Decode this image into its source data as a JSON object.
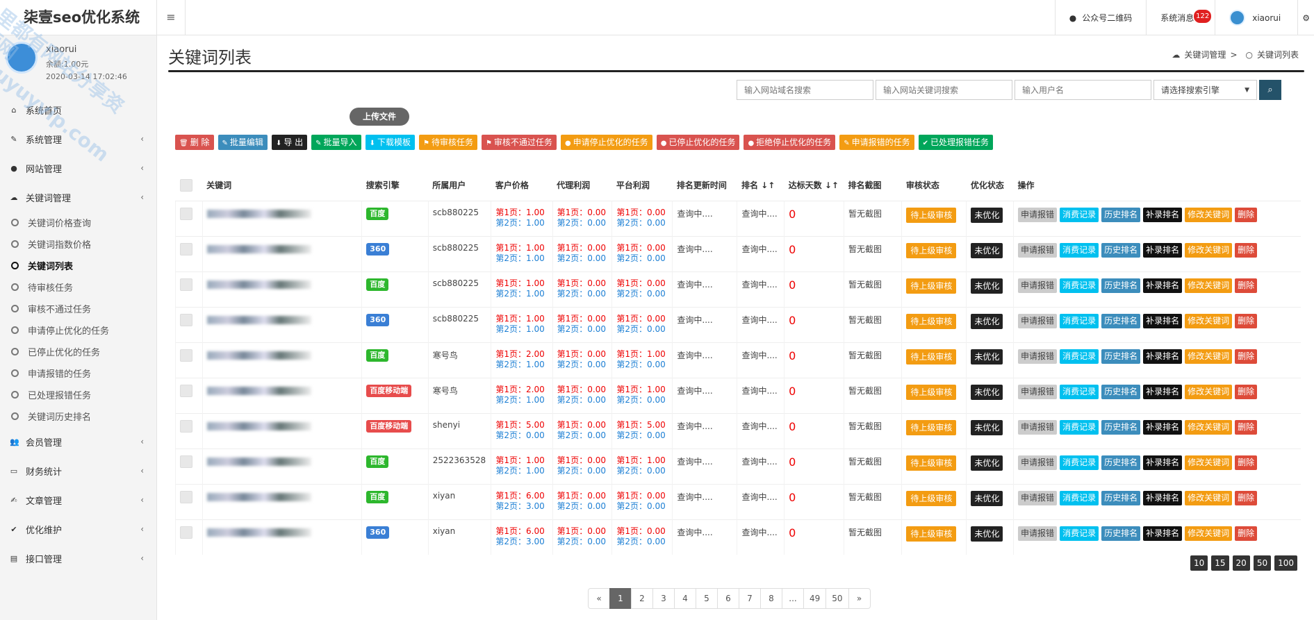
{
  "brand": "柒壹seo优化系统",
  "topbar": {
    "menu_icon": "≡",
    "wechat": "公众号二维码",
    "messages": "系统消息",
    "msg_count": "122",
    "user": "xiaorui",
    "gear": "⚙"
  },
  "user": {
    "name": "xiaorui",
    "balance": "余额:1.00元",
    "time": "2020-03-14 17:02:46"
  },
  "watermark": {
    "line1": "里都有网站分享资源网",
    "line2": "uyuyvip.com"
  },
  "sidebar": {
    "items": [
      {
        "label": "系统首页",
        "icon": "⌂"
      },
      {
        "label": "系统管理",
        "icon": "✎",
        "arrow": "‹"
      },
      {
        "label": "网站管理",
        "icon": "●",
        "arrow": "‹"
      },
      {
        "label": "关键词管理",
        "icon": "☁",
        "arrow": "‹"
      },
      {
        "label": "会员管理",
        "icon": "👥",
        "arrow": "‹"
      },
      {
        "label": "财务统计",
        "icon": "▭",
        "arrow": "‹"
      },
      {
        "label": "文章管理",
        "icon": "✍",
        "arrow": "‹"
      },
      {
        "label": "优化维护",
        "icon": "✔",
        "arrow": "‹"
      },
      {
        "label": "接口管理",
        "icon": "▤",
        "arrow": "‹"
      }
    ],
    "sub": [
      "关键词价格查询",
      "关键词指数价格",
      "关键词列表",
      "待审核任务",
      "审核不通过任务",
      "申请停止优化的任务",
      "已停止优化的任务",
      "申请报错的任务",
      "已处理报错任务",
      "关键词历史排名"
    ]
  },
  "page": {
    "title": "关键词列表",
    "crumb1": "关键词管理",
    "crumb_sep": ">",
    "crumb2": "关键词列表"
  },
  "search": {
    "domain_ph": "输入网站域名搜索",
    "kw_ph": "输入网站关键词搜索",
    "user_ph": "输入用户名",
    "engine": "请选择搜索引擎",
    "arrow": "▼",
    "icon": "🔍"
  },
  "upload": "上传文件",
  "toolbar": [
    "删 除",
    "批量编辑",
    "导 出",
    "批量导入",
    "下载模板",
    "待审核任务",
    "审核不通过任务",
    "申请停止优化的任务",
    "已停止优化的任务",
    "拒绝停止优化的任务",
    "申请报错的任务",
    "已处理报错任务"
  ],
  "toolbar_icons": [
    "🗑",
    "✎",
    "⬇",
    "✎",
    "⬇",
    "⚑",
    "⚑",
    "●",
    "●",
    "●",
    "✎",
    "✔"
  ],
  "table": {
    "headers": [
      "",
      "关键词",
      "",
      "搜索引擎",
      "所属用户",
      "客户价格",
      "代理利润",
      "平台利润",
      "排名更新时间",
      "排名 ↓↑",
      "达标天数 ↓↑",
      "排名截图",
      "审核状态",
      "优化状态",
      "操作"
    ],
    "rows": [
      {
        "engine": "百度",
        "user": "scb880225",
        "p1": "第1页：1.00",
        "p2": "第2页：1.00",
        "a1": "第1页：0.00",
        "a2": "第2页：0.00",
        "f1": "第1页：0.00",
        "f2": "第2页：0.00"
      },
      {
        "engine": "360",
        "user": "scb880225",
        "p1": "第1页：1.00",
        "p2": "第2页：1.00",
        "a1": "第1页：0.00",
        "a2": "第2页：0.00",
        "f1": "第1页：0.00",
        "f2": "第2页：0.00"
      },
      {
        "engine": "百度",
        "user": "scb880225",
        "p1": "第1页：1.00",
        "p2": "第2页：1.00",
        "a1": "第1页：0.00",
        "a2": "第2页：0.00",
        "f1": "第1页：0.00",
        "f2": "第2页：0.00"
      },
      {
        "engine": "360",
        "user": "scb880225",
        "p1": "第1页：1.00",
        "p2": "第2页：1.00",
        "a1": "第1页：0.00",
        "a2": "第2页：0.00",
        "f1": "第1页：0.00",
        "f2": "第2页：0.00"
      },
      {
        "engine": "百度",
        "user": "寒号鸟",
        "p1": "第1页：2.00",
        "p2": "第2页：1.00",
        "a1": "第1页：0.00",
        "a2": "第2页：0.00",
        "f1": "第1页：1.00",
        "f2": "第2页：0.00"
      },
      {
        "engine": "百度移动端",
        "user": "寒号鸟",
        "p1": "第1页：2.00",
        "p2": "第2页：1.00",
        "a1": "第1页：0.00",
        "a2": "第2页：0.00",
        "f1": "第1页：1.00",
        "f2": "第2页：0.00"
      },
      {
        "engine": "百度移动端",
        "user": "shenyi",
        "p1": "第1页：5.00",
        "p2": "第2页：0.00",
        "a1": "第1页：0.00",
        "a2": "第2页：0.00",
        "f1": "第1页：5.00",
        "f2": "第2页：0.00"
      },
      {
        "engine": "百度",
        "user": "2522363528",
        "p1": "第1页：1.00",
        "p2": "第2页：1.00",
        "a1": "第1页：0.00",
        "a2": "第2页：0.00",
        "f1": "第1页：1.00",
        "f2": "第2页：0.00"
      },
      {
        "engine": "百度",
        "user": "xiyan",
        "p1": "第1页：6.00",
        "p2": "第2页：3.00",
        "a1": "第1页：0.00",
        "a2": "第2页：0.00",
        "f1": "第1页：0.00",
        "f2": "第2页：0.00"
      },
      {
        "engine": "360",
        "user": "xiyan",
        "p1": "第1页：6.00",
        "p2": "第2页：3.00",
        "a1": "第1页：0.00",
        "a2": "第2页：0.00",
        "f1": "第1页：0.00",
        "f2": "第2页：0.00"
      }
    ],
    "querying": "查询中....",
    "rank": "查询中....",
    "days": "0",
    "screenshot": "暂无截图",
    "audit": "待上级审核",
    "opt": "未优化",
    "ops": [
      "申请报错",
      "消费记录",
      "历史排名",
      "补录排名",
      "修改关键词",
      "删除"
    ]
  },
  "pagesize": [
    "10",
    "15",
    "20",
    "50",
    "100"
  ],
  "pager": [
    "«",
    "1",
    "2",
    "3",
    "4",
    "5",
    "6",
    "7",
    "8",
    "...",
    "49",
    "50",
    "»"
  ],
  "colors": {
    "accent": "#3c8dbc",
    "orange": "#f39c12",
    "red": "#dd4b39",
    "green": "#00a65a"
  }
}
